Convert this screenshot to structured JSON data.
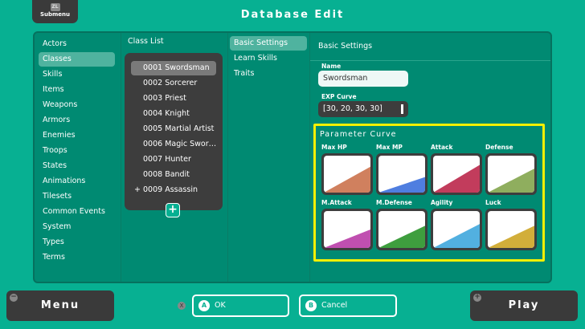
{
  "header": {
    "title": "Database Edit",
    "submenu_label": "Submenu",
    "submenu_key": "ZL"
  },
  "sidebar": {
    "items": [
      "Actors",
      "Classes",
      "Skills",
      "Items",
      "Weapons",
      "Armors",
      "Enemies",
      "Troops",
      "States",
      "Animations",
      "Tilesets",
      "Common Events",
      "System",
      "Types",
      "Terms"
    ],
    "selected": "Classes"
  },
  "class_list": {
    "title": "Class List",
    "items": [
      "0001 Swordsman",
      "0002 Sorcerer",
      "0003 Priest",
      "0004 Knight",
      "0005 Martial Artist",
      "0006 Magic Swor…",
      "0007 Hunter",
      "0008 Bandit",
      "0009 Assassin"
    ],
    "selected": "0001 Swordsman",
    "add_marker": "+",
    "add_button": "+"
  },
  "tabs": {
    "items": [
      "Basic Settings",
      "Learn Skills",
      "Traits"
    ],
    "selected": "Basic Settings"
  },
  "basic": {
    "title": "Basic Settings",
    "name_label": "Name",
    "name_value": "Swordsman",
    "exp_label": "EXP Curve",
    "exp_value": "[30, 20, 30, 30]"
  },
  "param_curve": {
    "title": "Parameter Curve",
    "params": [
      {
        "label": "Max HP",
        "color": "#d0805e",
        "level": 0.7
      },
      {
        "label": "Max MP",
        "color": "#4f7ee0",
        "level": 0.42
      },
      {
        "label": "Attack",
        "color": "#c23c5c",
        "level": 0.75
      },
      {
        "label": "Defense",
        "color": "#8fae5e",
        "level": 0.65
      },
      {
        "label": "M.Attack",
        "color": "#c04fb0",
        "level": 0.5
      },
      {
        "label": "M.Defense",
        "color": "#3e9e3e",
        "level": 0.6
      },
      {
        "label": "Agility",
        "color": "#52b0e0",
        "level": 0.65
      },
      {
        "label": "Luck",
        "color": "#d2ae3a",
        "level": 0.6
      }
    ]
  },
  "footer": {
    "menu": "Menu",
    "menu_key": "−",
    "play": "Play",
    "play_key": "+",
    "ok": "OK",
    "ok_key": "A",
    "cancel": "Cancel",
    "cancel_key": "B",
    "x_key": "X"
  }
}
